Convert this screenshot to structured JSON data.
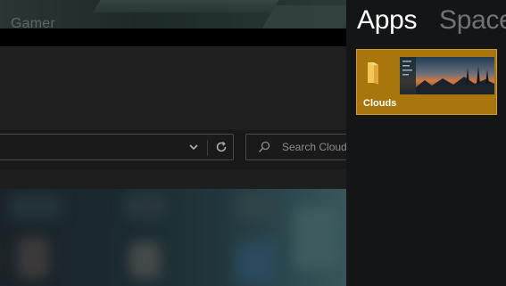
{
  "background_window": {
    "title": "Gamer"
  },
  "explorer": {
    "address_value": "",
    "search_placeholder": "Search Cloud"
  },
  "start_panel": {
    "tabs": [
      "Apps",
      "Spaces"
    ],
    "active_tab": "Apps",
    "tiles": [
      {
        "label": "Clouds",
        "icon": "folder-icon"
      }
    ]
  },
  "colors": {
    "tile_accent": "#a8760d",
    "panel_bg": "#141517",
    "explorer_bg": "#1c1c1c"
  }
}
